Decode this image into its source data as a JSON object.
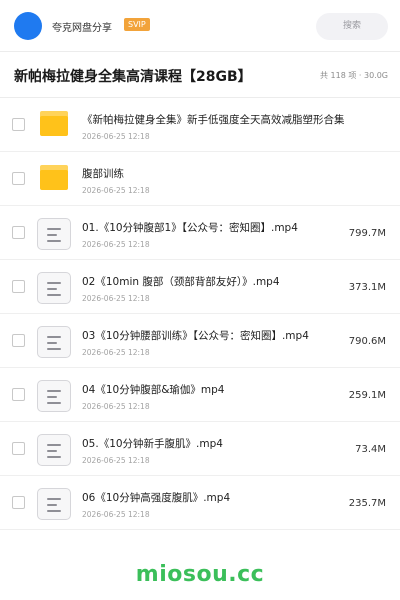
{
  "header": {
    "share_name": "夸克网盘分享",
    "badge": "SVIP",
    "search_placeholder": "搜索"
  },
  "title": "新帕梅拉健身全集高清课程【28GB】",
  "meta": "共 118 项 · 30.0G",
  "files": [
    {
      "type": "folder",
      "name": "《新帕梅拉健身全集》新手低强度全天高效减脂塑形合集",
      "date": "2026-06-25 12:18",
      "size": ""
    },
    {
      "type": "folder",
      "name": "腹部训练",
      "date": "2026-06-25 12:18",
      "size": ""
    },
    {
      "type": "file",
      "name": "01.《10分钟腹部1》【公众号：密知圈】.mp4",
      "date": "2026-06-25 12:18",
      "size": "799.7M"
    },
    {
      "type": "file",
      "name": "02《10min 腹部（颈部背部友好）》.mp4",
      "date": "2026-06-25 12:18",
      "size": "373.1M"
    },
    {
      "type": "file",
      "name": "03《10分钟腰部训练》【公众号：密知圈】.mp4",
      "date": "2026-06-25 12:18",
      "size": "790.6M"
    },
    {
      "type": "file",
      "name": "04《10分钟腹部&瑜伽》mp4",
      "date": "2026-06-25 12:18",
      "size": "259.1M"
    },
    {
      "type": "file",
      "name": "05.《10分钟新手腹肌》.mp4",
      "date": "2026-06-25 12:18",
      "size": "73.4M"
    },
    {
      "type": "file",
      "name": "06《10分钟高强度腹肌》.mp4",
      "date": "2026-06-25 12:18",
      "size": "235.7M"
    }
  ],
  "watermark": "miosou.cc",
  "colors": {
    "accent": "#1f7af0",
    "badge": "#f2a33a",
    "folder": "#ffc21a",
    "watermark": "#3bbf5a"
  }
}
